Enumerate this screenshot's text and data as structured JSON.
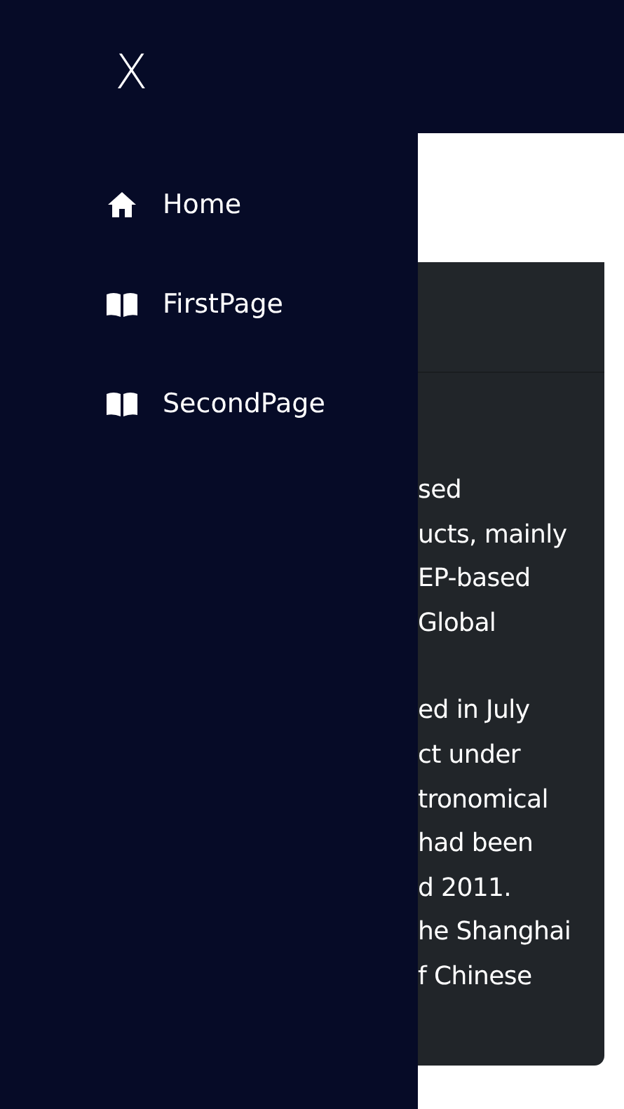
{
  "sidebar": {
    "close": "X",
    "items": [
      {
        "label": "Home",
        "kind": "home"
      },
      {
        "label": "FirstPage",
        "kind": "book"
      },
      {
        "label": "SecondPage",
        "kind": "book"
      }
    ]
  },
  "card": {
    "paragraphs": [
      [
        "sed",
        "ucts, mainly",
        "EP-based",
        "Global"
      ],
      [
        "ed in July",
        "ct under",
        "tronomical",
        "had been",
        "d 2011.",
        "he Shanghai",
        "f Chinese"
      ]
    ]
  }
}
